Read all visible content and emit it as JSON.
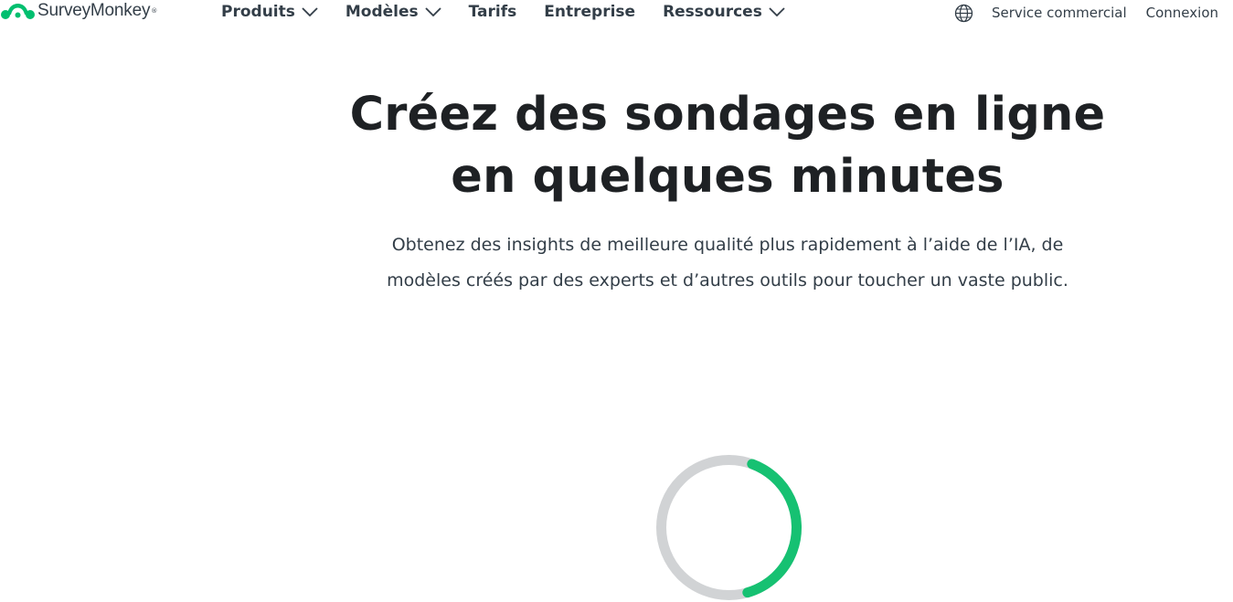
{
  "brand": {
    "name": "SurveyMonkey",
    "registered_mark": "®",
    "logo_icon": "surveymonkey-logo-icon",
    "color": "#00bf6f"
  },
  "nav": {
    "items": [
      {
        "label": "Produits",
        "has_dropdown": true
      },
      {
        "label": "Modèles",
        "has_dropdown": true
      },
      {
        "label": "Tarifs",
        "has_dropdown": false
      },
      {
        "label": "Entreprise",
        "has_dropdown": false
      },
      {
        "label": "Ressources",
        "has_dropdown": true
      }
    ],
    "language_icon": "globe-icon",
    "sales_link": "Service commercial",
    "login_link": "Connexion"
  },
  "hero": {
    "title_line1": "Créez des sondages en ligne",
    "title_line2": "en quelques minutes",
    "subtitle_line1": "Obtenez des insights de meilleure qualité plus rapidement à l’aide de l’IA, de",
    "subtitle_line2": "modèles créés par des experts et d’autres outils pour toucher un vaste public."
  },
  "loader": {
    "icon": "loading-spinner-icon",
    "progress": 0.4,
    "track_color": "#d1d3d5",
    "fill_color": "#16c172"
  }
}
